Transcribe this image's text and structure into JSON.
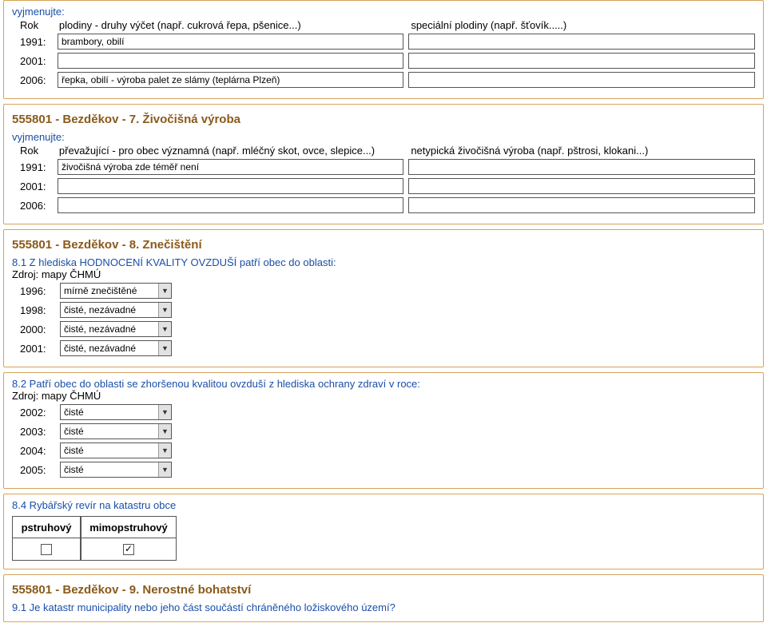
{
  "topList": {
    "listLabel": "vyjmenujte:",
    "headRow": {
      "year": "Rok",
      "left": "plodiny - druhy výčet (např. cukrová řepa, pšenice...)",
      "right": "speciální plodiny (např. šťovík.....)"
    },
    "rows": [
      {
        "year": "1991:",
        "left": "brambory, obilí",
        "right": ""
      },
      {
        "year": "2001:",
        "left": "",
        "right": ""
      },
      {
        "year": "2006:",
        "left": "řepka, obilí - výroba palet ze slámy (teplárna Plzeň)",
        "right": ""
      }
    ]
  },
  "section7": {
    "heading": "555801 - Bezděkov - 7. Živočišná výroba",
    "listLabel": "vyjmenujte:",
    "headRow": {
      "year": "Rok",
      "left": "převažující - pro obec významná (např. mléčný skot, ovce, slepice...)",
      "right": "netypická živočišná výroba (např. pštrosi, klokani...)"
    },
    "rows": [
      {
        "year": "1991:",
        "left": "živočišná výroba zde téměř není",
        "right": ""
      },
      {
        "year": "2001:",
        "left": "",
        "right": ""
      },
      {
        "year": "2006:",
        "left": "",
        "right": ""
      }
    ]
  },
  "section8": {
    "heading": "555801 - Bezděkov - 8. Znečištění",
    "q81": {
      "title": "8.1 Z hlediska HODNOCENÍ KVALITY OVZDUŠÍ patří obec do oblasti:",
      "source": "Zdroj: mapy ČHMÚ",
      "rows": [
        {
          "year": "1996:",
          "val": "mírně znečištěné"
        },
        {
          "year": "1998:",
          "val": "čisté, nezávadné"
        },
        {
          "year": "2000:",
          "val": "čisté, nezávadné"
        },
        {
          "year": "2001:",
          "val": "čisté, nezávadné"
        }
      ]
    },
    "q82": {
      "title": "8.2 Patří obec do oblasti se zhoršenou kvalitou ovzduší z hlediska ochrany zdraví v roce:",
      "source": "Zdroj: mapy ČHMÚ",
      "rows": [
        {
          "year": "2002:",
          "val": "čisté"
        },
        {
          "year": "2003:",
          "val": "čisté"
        },
        {
          "year": "2004:",
          "val": "čisté"
        },
        {
          "year": "2005:",
          "val": "čisté"
        }
      ]
    },
    "q84": {
      "title": "8.4 Rybářský revír na katastru obce",
      "cols": {
        "c1": "pstruhový",
        "c2": "mimopstruhový"
      },
      "vals": {
        "c1": false,
        "c2": true
      }
    }
  },
  "section9": {
    "heading": "555801 - Bezděkov - 9. Nerostné bohatství",
    "q91": "9.1 Je katastr municipality nebo jeho část součástí chráněného ložiskového území?"
  }
}
